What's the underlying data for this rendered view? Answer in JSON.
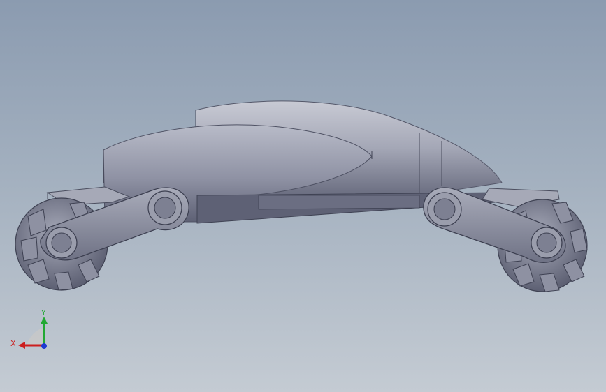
{
  "viewport": {
    "background_top": "#8b9bb0",
    "background_bottom": "#c4cbd3"
  },
  "model": {
    "body_color": "#8a8d9f",
    "wheel_color": "#7d8092"
  },
  "triad": {
    "x_label": "X",
    "y_label": "Y",
    "x_color": "#cc1f1f",
    "y_color": "#22a833",
    "z_color": "#1f3ad1"
  }
}
